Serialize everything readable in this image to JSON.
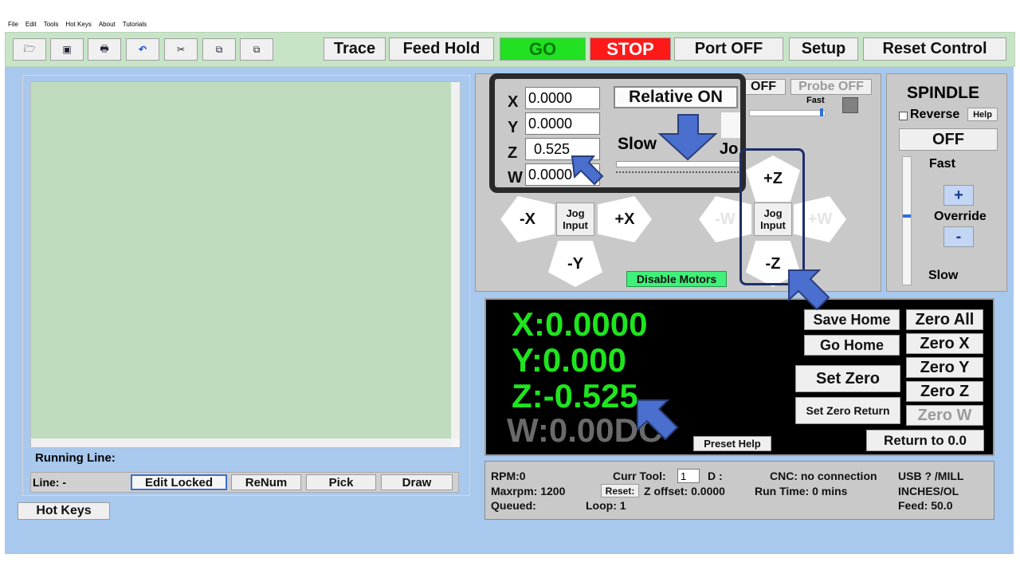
{
  "menu": [
    "File",
    "Edit",
    "Tools",
    "Hot Keys",
    "About",
    "Tutorials"
  ],
  "toolbar": {
    "icons": [
      "open-folder-icon",
      "save-icon",
      "print-icon",
      "undo-icon",
      "cut-icon",
      "copy-icon",
      "paste-icon"
    ],
    "icon_glyphs": [
      "🗁",
      "▣",
      "🖶",
      "↶",
      "✂",
      "⧉",
      "⧉"
    ],
    "trace": "Trace",
    "feed_hold": "Feed Hold",
    "go": "GO",
    "stop": "STOP",
    "port": "Port OFF",
    "setup": "Setup",
    "reset_control": "Reset Control"
  },
  "colors": {
    "go_bg": "#22e022",
    "go_text": "#0a7a0a",
    "stop_bg": "#ff1a1a",
    "stop_text": "#ffffff",
    "dro_green": "#1ee51e",
    "disable_motors": "#3ff07a",
    "arrow_blue": "#4a6fce"
  },
  "editor": {
    "running_line_label": "Running Line:",
    "line_label": "Line: -",
    "edit_locked": "Edit Locked",
    "renum": "ReNum",
    "pick": "Pick",
    "draw": "Draw"
  },
  "hot_keys": "Hot Keys",
  "jog": {
    "x_label": "X",
    "y_label": "Y",
    "z_label": "Z",
    "w_label": "W",
    "x_value": "0.0000",
    "y_value": "0.0000",
    "z_value": "0.525",
    "w_value": "0.0000",
    "relative": "Relative ON",
    "slow": "Slow",
    "jog_partial": "Jo",
    "fast": "Fast",
    "off_partial": "OFF",
    "probe": "Probe OFF",
    "minus_x": "-X",
    "plus_x": "+X",
    "minus_y": "-Y",
    "plus_z": "+Z",
    "minus_z": "-Z",
    "minus_w": "-W",
    "plus_w": "+W",
    "jog_input_1": "Jog",
    "jog_input_2": "Input",
    "disable_motors": "Disable Motors"
  },
  "spindle": {
    "title": "SPINDLE",
    "reverse": "Reverse",
    "help": "Help",
    "state": "OFF",
    "fast": "Fast",
    "plus": "+",
    "override": "Override",
    "minus": "-",
    "slow": "Slow"
  },
  "dro": {
    "x": "X:0.0000",
    "y": "Y:0.000",
    "z": "Z:-0.525",
    "w": "W:0.00DC",
    "save_home": "Save Home",
    "go_home": "Go Home",
    "set_zero": "Set Zero",
    "set_zero_return": "Set Zero Return",
    "zero_all": "Zero All",
    "zero_x": "Zero X",
    "zero_y": "Zero Y",
    "zero_z": "Zero Z",
    "zero_w": "Zero W",
    "preset_help": "Preset Help",
    "return_to": "Return to 0.0"
  },
  "status": {
    "rpm": "RPM:0",
    "maxrpm": "Maxrpm: 1200",
    "queued": "Queued:",
    "curr_tool_label": "Curr Tool:",
    "curr_tool_value": "1",
    "d_label": "D :",
    "reset": "Reset:",
    "z_offset": "Z offset: 0.0000",
    "loop": "Loop: 1",
    "cnc": "CNC: no connection",
    "run_time": "Run Time: 0 mins",
    "usb": "USB ? /MILL",
    "units": "INCHES/OL",
    "feed": "Feed: 50.0"
  }
}
